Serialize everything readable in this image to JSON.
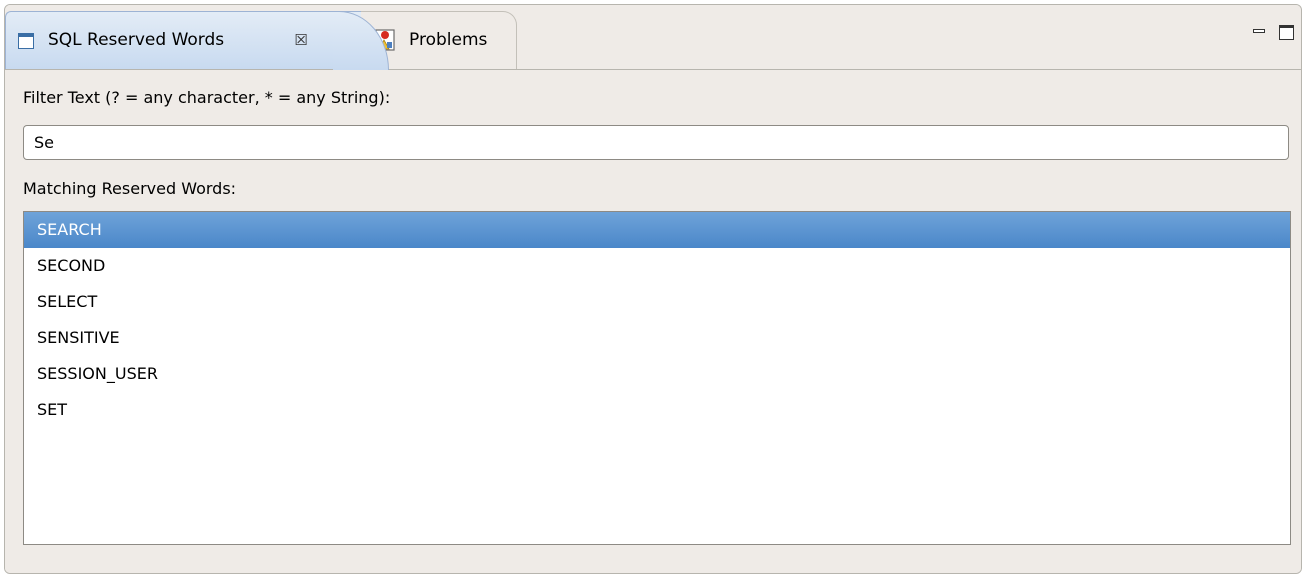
{
  "tabs": {
    "active": {
      "label": "SQL Reserved Words",
      "close_glyph": "☒"
    },
    "inactive": {
      "label": "Problems"
    }
  },
  "view_controls": {
    "minimize_icon": "minimize-icon",
    "maximize_icon": "maximize-icon"
  },
  "filter": {
    "label": "Filter Text (? = any character, * = any String):",
    "value": "Se"
  },
  "matching": {
    "label": "Matching Reserved Words:",
    "items": [
      "SEARCH",
      "SECOND",
      "SELECT",
      "SENSITIVE",
      "SESSION_USER",
      "SET"
    ],
    "selected_index": 0
  },
  "colors": {
    "selection": "#4a87c9",
    "panel_background": "#efebe7",
    "active_tab": "#c8daf0"
  }
}
